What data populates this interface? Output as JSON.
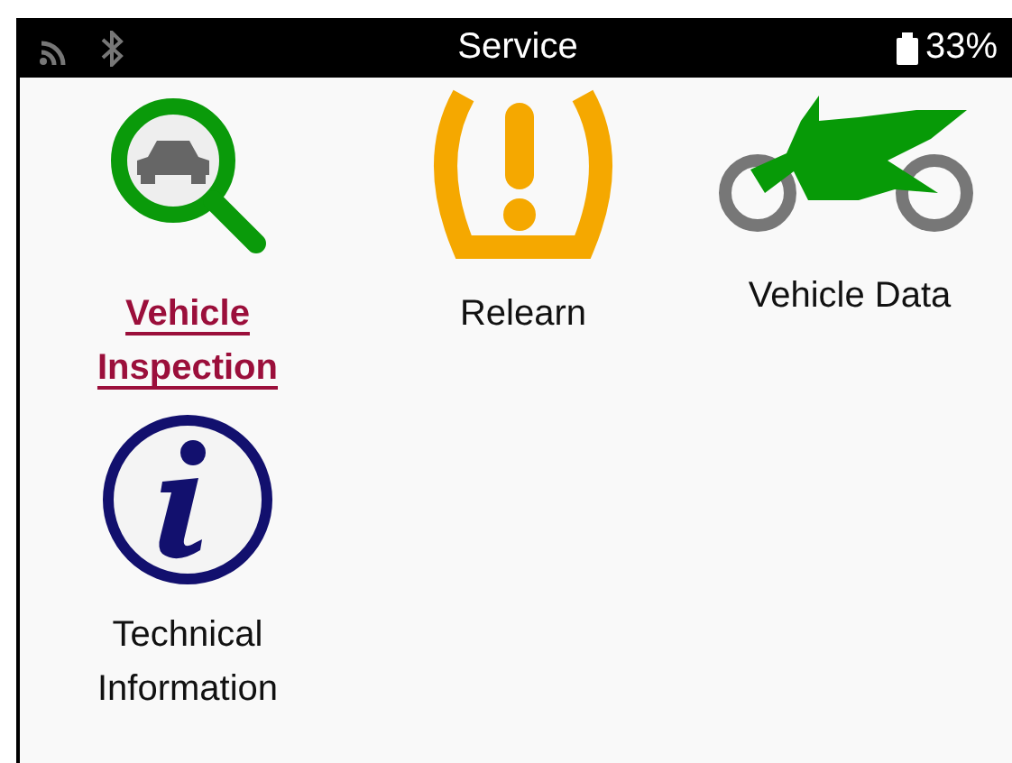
{
  "status_bar": {
    "title": "Service",
    "battery": "33%"
  },
  "items": [
    {
      "kind": "inspection",
      "label": "Vehicle Inspection",
      "selected": true
    },
    {
      "kind": "relearn",
      "label": "Relearn",
      "selected": false
    },
    {
      "kind": "vehicle-data",
      "label": "Vehicle Data",
      "selected": false
    },
    {
      "kind": "info",
      "label": "Technical Information",
      "selected": false
    }
  ]
}
